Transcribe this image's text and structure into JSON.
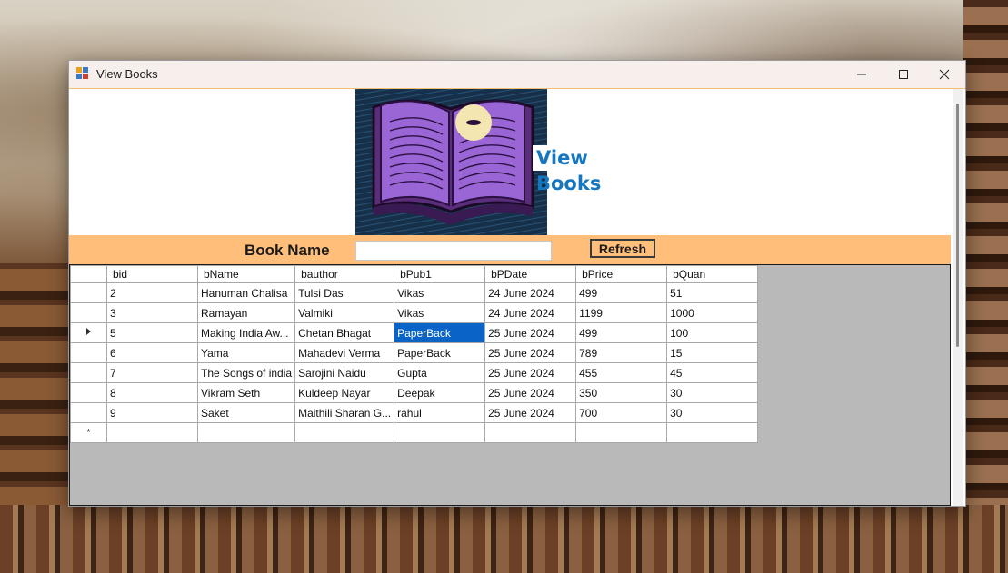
{
  "window": {
    "title": "View Books"
  },
  "header": {
    "heading": "View Books"
  },
  "search": {
    "label": "Book Name",
    "value": "",
    "refresh_label": "Refresh"
  },
  "grid": {
    "columns": [
      "bid",
      "bName",
      "bauthor",
      "bPub1",
      "bPDate",
      "bPrice",
      "bQuan"
    ],
    "rows": [
      [
        "2",
        "Hanuman Chalisa",
        "Tulsi Das",
        "Vikas",
        "24 June 2024",
        "499",
        "51"
      ],
      [
        "3",
        "Ramayan",
        "Valmiki",
        "Vikas",
        "24 June 2024",
        "1199",
        "1000"
      ],
      [
        "5",
        "Making India Aw...",
        "Chetan Bhagat",
        "PaperBack",
        "25 June 2024",
        "499",
        "100"
      ],
      [
        "6",
        "Yama",
        "Mahadevi Verma",
        "PaperBack",
        "25 June 2024",
        "789",
        "15"
      ],
      [
        "7",
        "The Songs of india",
        "Sarojini Naidu",
        "Gupta",
        "25 June 2024",
        "455",
        "45"
      ],
      [
        "8",
        "Vikram Seth",
        "Kuldeep Nayar",
        "Deepak",
        "25 June 2024",
        "350",
        "30"
      ],
      [
        "9",
        "Saket",
        "Maithili Sharan G...",
        "rahul",
        "25 June 2024",
        "700",
        "30"
      ]
    ],
    "new_row_marker": "*"
  },
  "colors": {
    "accent": "#1577c0",
    "strip": "#ffbf7a",
    "selection": "#0a64c8",
    "grid_background": "#b9b9b9"
  }
}
